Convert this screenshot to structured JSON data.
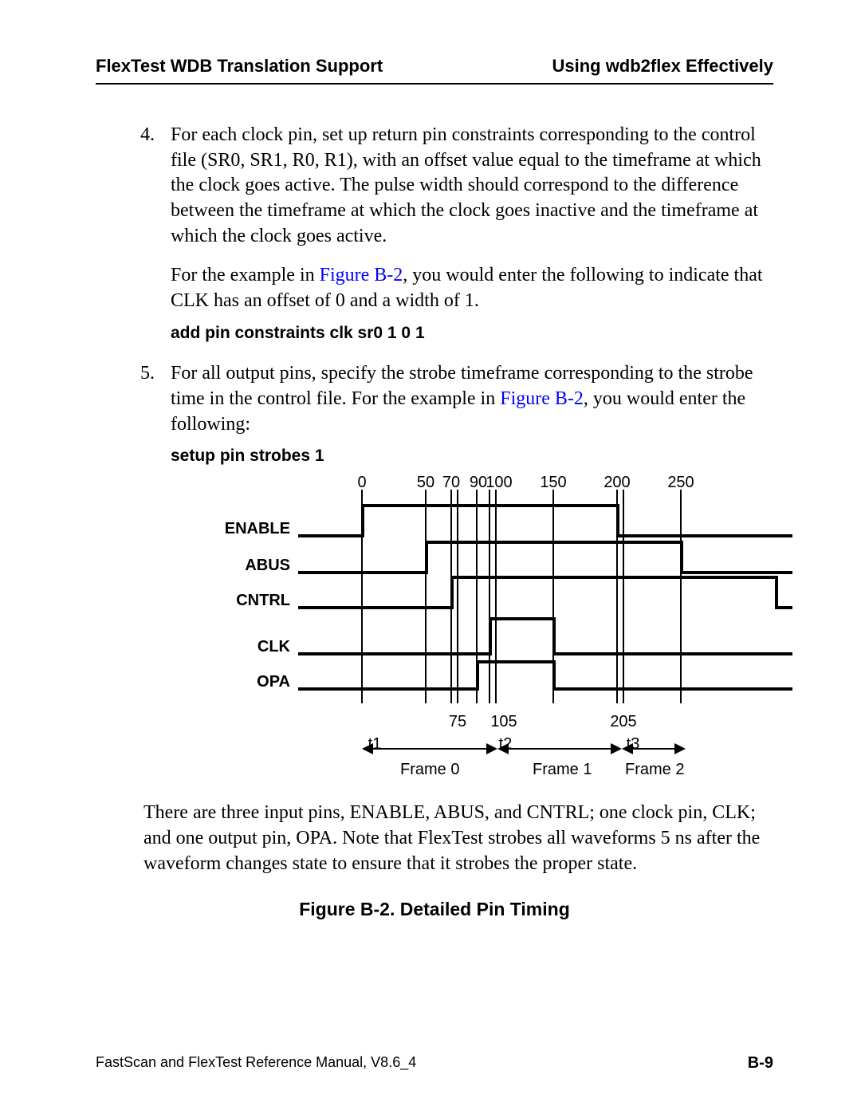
{
  "header": {
    "left": "FlexTest WDB Translation Support",
    "right": "Using wdb2flex Effectively"
  },
  "list": {
    "item4": {
      "num": "4.",
      "p1_a": "For each clock pin, set up return pin constraints corresponding to the control file (SR0, SR1, R0, R1), with an offset value equal to the timeframe at which the clock goes active. The pulse width should correspond to the difference between the timeframe at which the clock goes inactive and the timeframe at which the clock goes active.",
      "p2_a": "For the example in ",
      "p2_link": "Figure B-2",
      "p2_b": ", you would enter the following to indicate that CLK has an offset of 0 and a width of 1.",
      "cmd": "add pin constraints clk sr0 1 0 1"
    },
    "item5": {
      "num": "5.",
      "p1_a": "For all output pins, specify the strobe timeframe corresponding to the strobe time in the control file. For the example in ",
      "p1_link": "Figure B-2",
      "p1_b": ", you would enter the following:",
      "cmd": "setup pin strobes 1"
    }
  },
  "chart_data": {
    "type": "timing",
    "top_ticks": {
      "0": 180,
      "50": 260,
      "70": 292,
      "90": 324,
      "100": 340,
      "150": 420,
      "200": 500,
      "250": 580
    },
    "bottom_ticks": {
      "75": 300,
      "105": 348,
      "205": 508
    },
    "signals": [
      "ENABLE",
      "ABUS",
      "CNTRL",
      "CLK",
      "OPA"
    ],
    "frames": {
      "t1": "t1",
      "t2": "t2",
      "t3": "t3",
      "f0": "Frame 0",
      "f1": "Frame 1",
      "f2": "Frame 2"
    }
  },
  "after_figure": "There are three input pins, ENABLE, ABUS, and CNTRL; one clock pin, CLK; and one output pin, OPA. Note that FlexTest strobes all waveforms 5 ns after the waveform changes state to ensure that it strobes the proper state.",
  "figure_caption": "Figure B-2. Detailed Pin Timing",
  "footer": {
    "left": "FastScan and FlexTest Reference Manual, V8.6_4",
    "right": "B-9"
  }
}
